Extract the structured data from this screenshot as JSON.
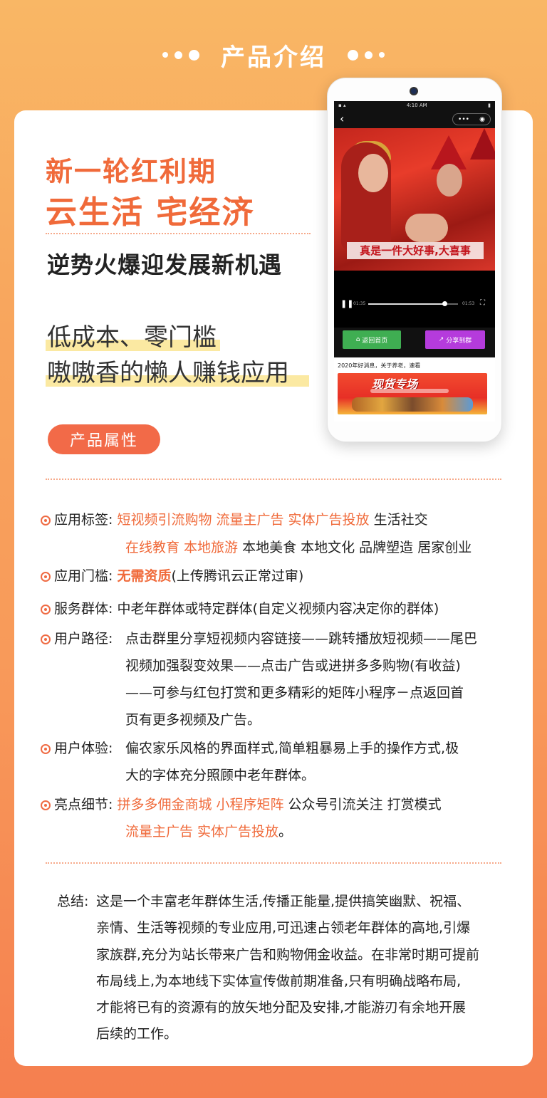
{
  "header": {
    "title": "产品介绍"
  },
  "headline": {
    "line1": "新一轮红利期",
    "line2": "云生活 宅经济"
  },
  "subheadline": "逆势火爆迎发展新机遇",
  "highlights": {
    "line1": "低成本、零门槛",
    "line2": "嗷嗷香的懒人赚钱应用"
  },
  "badge": "产品属性",
  "phone": {
    "status_time": "4:10 AM",
    "caption": "真是一件大好事,大喜事",
    "time_elapsed": "01:35",
    "time_total": "01:53",
    "home_button": "返回首页",
    "share_button": "分享到群",
    "info_text": "2020年好消息，关于养老，速看",
    "banner_title": "现货专场",
    "colors": {
      "home": "#3fae52",
      "share": "#b53bdc"
    }
  },
  "attributes": {
    "tags": {
      "label": "应用标签:",
      "line1_orange": "短视频引流购物 流量主广告 实体广告投放",
      "line1_black": " 生活社交",
      "line2_orange": "在线教育 本地旅游",
      "line2_black": " 本地美食 本地文化 品牌塑造 居家创业"
    },
    "threshold": {
      "label": "应用门槛:",
      "orange": "无需资质",
      "black": "(上传腾讯云正常过审)"
    },
    "audience": {
      "label": "服务群体:",
      "text": "中老年群体或特定群体(自定义视频内容决定你的群体)"
    },
    "path": {
      "label": "用户路径:",
      "lines": [
        "点击群里分享短视频内容链接——跳转播放短视频——尾巴",
        "视频加强裂变效果——点击广告或进拼多多购物(有收益)",
        "——可参与红包打赏和更多精彩的矩阵小程序－点返回首",
        "页有更多视频及广告。"
      ]
    },
    "experience": {
      "label": "用户体验:",
      "lines": [
        "偏农家乐风格的界面样式,简单粗暴易上手的操作方式,极",
        "大的字体充分照顾中老年群体。"
      ]
    },
    "highlights": {
      "label": "亮点细节:",
      "line1_orange": "拼多多佣金商城 小程序矩阵",
      "line1_black": " 公众号引流关注  打赏模式",
      "line2_orange": "流量主广告 实体广告投放",
      "line2_black": "。"
    }
  },
  "summary": {
    "label": "总结:",
    "lines": [
      "这是一个丰富老年群体生活,传播正能量,提供搞笑幽默、祝福、",
      "亲情、生活等视频的专业应用,可迅速占领老年群体的高地,引爆",
      "家族群,充分为站长带来广告和购物佣金收益。在非常时期可提前",
      "布局线上,为本地线下实体宣传做前期准备,只有明确战略布局,",
      "才能将已有的资源有的放矢地分配及安排,才能游刃有余地开展",
      " 后续的工作。"
    ]
  }
}
